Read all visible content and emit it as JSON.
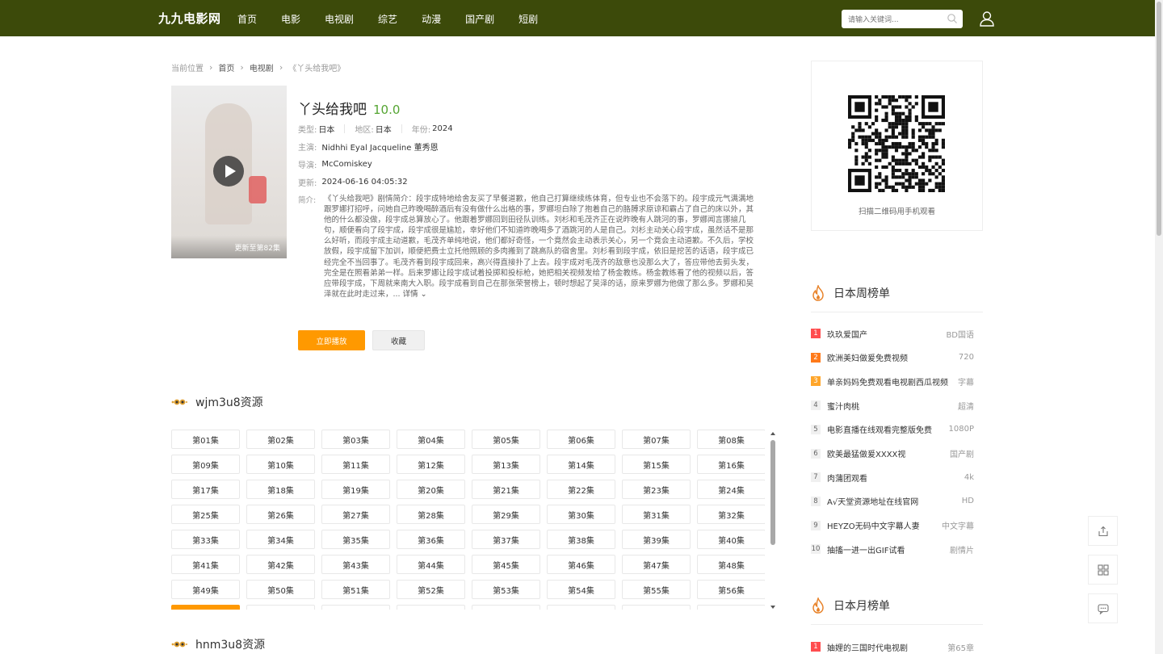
{
  "header": {
    "logo": "九九电影网",
    "nav": [
      "首页",
      "电影",
      "电视剧",
      "综艺",
      "动漫",
      "国产剧",
      "短剧"
    ],
    "search_placeholder": "请输入关键词..."
  },
  "breadcrumb": {
    "label": "当前位置",
    "items": [
      "首页",
      "电视剧",
      "《丫头给我吧》"
    ]
  },
  "movie": {
    "title": "丫头给我吧",
    "score": "10.0",
    "poster_status": "更新至第82集",
    "type_label": "类型:",
    "type": "日本",
    "region_label": "地区:",
    "region": "日本",
    "year_label": "年份:",
    "year": "2024",
    "cast_label": "主演:",
    "cast": "Nidhhi Eyal Jacqueline 董秀恩",
    "director_label": "导演:",
    "director": "McComiskey",
    "updated_label": "更新:",
    "updated": "2024-06-16 04:05:32",
    "desc_label": "简介:",
    "desc": "《丫头给我吧》剧情简介：段宇成特地给舍友买了早餐道歉，他自己打算继续练体育，但专业也不会落下的。段宇成元气满满地跟罗娜打招呼，问她自己昨晚喝醉酒后有没有做什么出格的事，罗娜坦白除了抱着自己的胳膊求原谅和霸占了自己的床以外，其他的什么都没做，段宇成总算放心了。他跟着罗娜回到田径队训练。刘杉和毛茂齐正在说昨晚有人跳河的事，罗娜闻言挪揄几句，顺便看向了段宇成，段宇成很是尴尬，幸好他们不知道昨晚喝多了酒跳河的人是自己。刘杉主动关心段宇成，虽然话不是那么好听，而段宇成主动道歉，毛茂齐单纯地说，他们都好奇怪，一个竟然会主动表示关心，另一个竟会主动道歉。不久后，学校放假，段宇成留下加训，顺便把费士立托他照顾的多肉搬到了跳高队的宿舍里。刘杉看到段宇成，依旧是挖苦的话语，段宇成已经完全不当回事了。毛茂齐看到段宇成回来，高兴得直接扑了上去。段宇成对毛茂齐的敌意也没那么大了，答应带他去剪头发，完全是在照看弟弟一样。后来罗娜让段宇成试着投掷和投标枪，她把相关视频发给了杨金教练。杨金教练看了他的视频以后，答应带段宇成，下周就来南大入职。段宇成看到自己在那张荣誉榜上，顿时想起了吴泽的话，原来罗娜为他做了那么多。罗娜和吴泽就在此时走过来，...",
    "desc_more": "详情",
    "play_button": "立即播放",
    "fav_button": "收藏"
  },
  "sources": [
    {
      "name": "wjm3u8资源",
      "episodes": [
        "第01集",
        "第02集",
        "第03集",
        "第04集",
        "第05集",
        "第06集",
        "第07集",
        "第08集",
        "第09集",
        "第10集",
        "第11集",
        "第12集",
        "第13集",
        "第14集",
        "第15集",
        "第16集",
        "第17集",
        "第18集",
        "第19集",
        "第20集",
        "第21集",
        "第22集",
        "第23集",
        "第24集",
        "第25集",
        "第26集",
        "第27集",
        "第28集",
        "第29集",
        "第30集",
        "第31集",
        "第32集",
        "第33集",
        "第34集",
        "第35集",
        "第36集",
        "第37集",
        "第38集",
        "第39集",
        "第40集",
        "第41集",
        "第42集",
        "第43集",
        "第44集",
        "第45集",
        "第46集",
        "第47集",
        "第48集",
        "第49集",
        "第50集",
        "第51集",
        "第52集",
        "第53集",
        "第54集",
        "第55集",
        "第56集",
        "",
        "",
        "",
        "",
        "",
        "",
        "",
        ""
      ]
    },
    {
      "name": "hnm3u8资源"
    }
  ],
  "sidebar": {
    "qr_text": "扫描二维码用手机观看",
    "weekly": {
      "title": "日本周榜单",
      "items": [
        {
          "no": "1",
          "name": "玖玖爱国产",
          "tag": "BD国语"
        },
        {
          "no": "2",
          "name": "欧洲美妇做爰免费视频",
          "tag": "720"
        },
        {
          "no": "3",
          "name": "单亲妈妈免费观看电视剧西瓜视频",
          "tag": "字幕"
        },
        {
          "no": "4",
          "name": "蜜汁肉桃",
          "tag": "超清"
        },
        {
          "no": "5",
          "name": "电影直播在线观看完整版免费",
          "tag": "1080P"
        },
        {
          "no": "6",
          "name": "欧美最猛做爰XXXⅩ视",
          "tag": "国产剧"
        },
        {
          "no": "7",
          "name": "肉蒲团观看",
          "tag": "4k"
        },
        {
          "no": "8",
          "name": "A√天堂资源地址在线官网",
          "tag": "HD"
        },
        {
          "no": "9",
          "name": "HEYZO无码中文字幕人妻",
          "tag": "中文字幕"
        },
        {
          "no": "10",
          "name": "抽搐一进一出GIF试看",
          "tag": "剧情片"
        }
      ]
    },
    "monthly": {
      "title": "日本月榜单",
      "items": [
        {
          "no": "1",
          "name": "妯娌的三国时代电视剧",
          "tag": "第65章"
        }
      ]
    }
  },
  "colors": {
    "header_bg": "#3c4a0a",
    "accent": "#ff9900",
    "score": "#55a532",
    "rank1": "#ff4d4f",
    "rank2": "#ff7a1a",
    "rank3": "#ffa62b"
  }
}
